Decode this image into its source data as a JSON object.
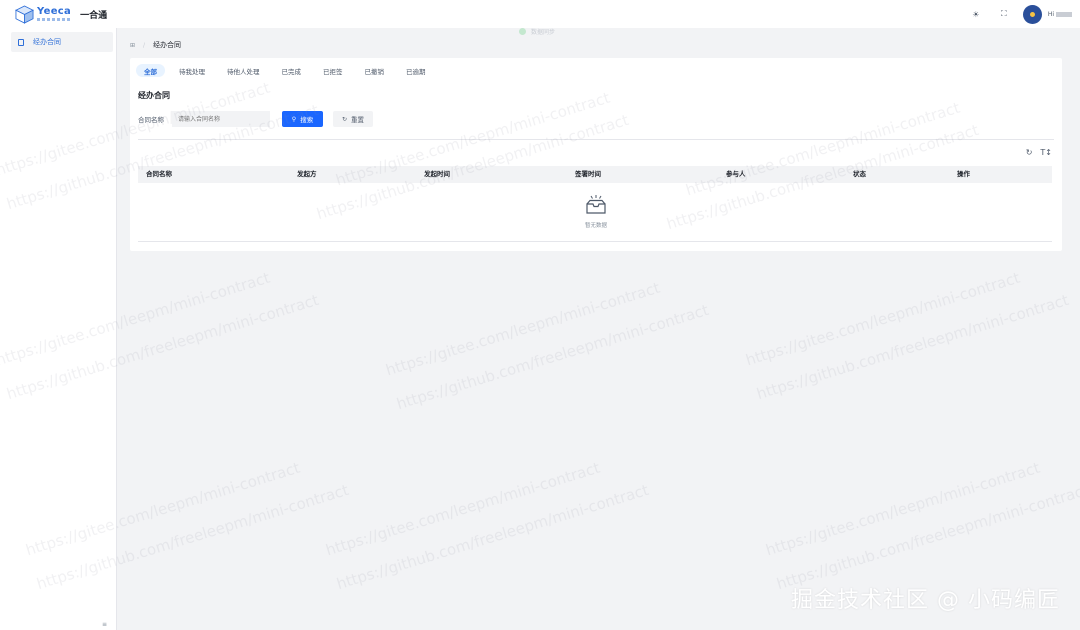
{
  "header": {
    "logo_word": "Yeeca",
    "app_name": "一合通",
    "status_text": "数据同步",
    "greeting": "Hi"
  },
  "sidebar": {
    "items": [
      {
        "label": "经办合同"
      }
    ],
    "collapse_symbol": "≡"
  },
  "breadcrumb": {
    "home": "⊞",
    "separator": "/",
    "current": "经办合同"
  },
  "tabs": [
    {
      "label": "全部",
      "active": true
    },
    {
      "label": "待我处理",
      "active": false
    },
    {
      "label": "待他人处理",
      "active": false
    },
    {
      "label": "已完成",
      "active": false
    },
    {
      "label": "已拒签",
      "active": false
    },
    {
      "label": "已撤销",
      "active": false
    },
    {
      "label": "已逾期",
      "active": false
    }
  ],
  "page_title": "经办合同",
  "filter": {
    "label": "合同名称",
    "placeholder": "请输入合同名称",
    "search_label": "搜索",
    "reset_label": "重置"
  },
  "table": {
    "columns": [
      "合同名称",
      "发起方",
      "发起时间",
      "签署时间",
      "参与人",
      "状态",
      "操作"
    ],
    "empty_text": "暂无数据"
  },
  "watermark_lines": [
    "https://gitee.com/leepm/mini-contract",
    "https://github.com/freeleepm/mini-contract"
  ],
  "footer_mark": "掘金技术社区 @ 小码编匠",
  "colors": {
    "primary": "#1a66ff",
    "brand": "#2f6fd8",
    "bg": "#f2f3f5"
  }
}
